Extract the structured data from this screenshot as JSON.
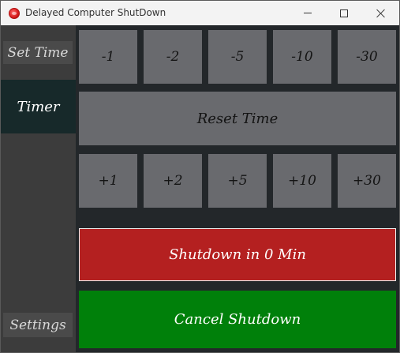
{
  "window": {
    "title": "Delayed Computer ShutDown"
  },
  "icons": {
    "app": "app-logo-icon",
    "minimize": "minimize-icon",
    "maximize": "maximize-icon",
    "close": "close-icon"
  },
  "sidebar": {
    "items": [
      {
        "label": "Set Time",
        "active": false
      },
      {
        "label": "Timer",
        "active": true
      },
      {
        "label": "Settings",
        "active": false
      }
    ]
  },
  "timer": {
    "decrement_labels": [
      "-1",
      "-2",
      "-5",
      "-10",
      "-30"
    ],
    "reset_label": "Reset Time",
    "increment_labels": [
      "+1",
      "+2",
      "+5",
      "+10",
      "+30"
    ]
  },
  "actions": {
    "shutdown_label": "Shutdown in 0 Min",
    "cancel_label": "Cancel Shutdown"
  },
  "colors": {
    "shutdown": "#b42020",
    "cancel": "#00800a",
    "timer_active": "#17292a",
    "time_button": "#696a6e"
  }
}
